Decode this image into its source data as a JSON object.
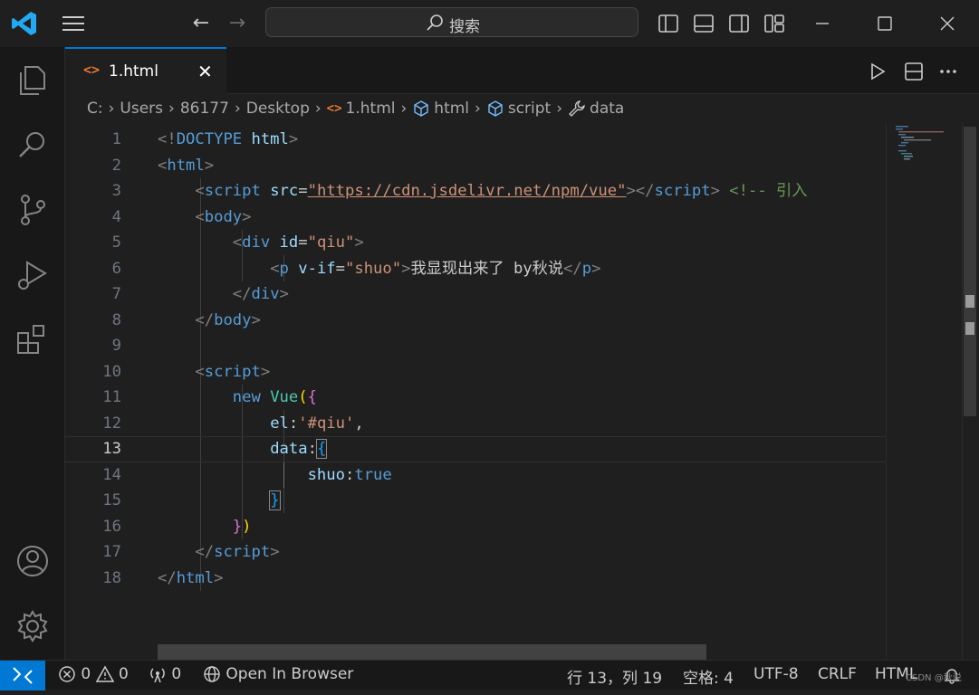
{
  "titlebar": {
    "search_placeholder": "搜索"
  },
  "tab": {
    "icon": "<>",
    "label": "1.html",
    "close": "✕"
  },
  "breadcrumb": {
    "items": [
      "C:",
      "Users",
      "86177",
      "Desktop",
      "1.html",
      "html",
      "script",
      "data"
    ]
  },
  "editor": {
    "line_numbers": [
      "1",
      "2",
      "3",
      "4",
      "5",
      "6",
      "7",
      "8",
      "9",
      "10",
      "11",
      "12",
      "13",
      "14",
      "15",
      "16",
      "17",
      "18"
    ],
    "current_line": "13",
    "lines": {
      "l1": {
        "a": "<!",
        "b": "DOCTYPE",
        "c": " html",
        "d": ">"
      },
      "l2": {
        "a": "<",
        "b": "html",
        "c": ">"
      },
      "l3": {
        "a": "<",
        "b": "script",
        "c": " src",
        "d": "=",
        "e": "\"https://cdn.jsdelivr.net/npm/vue\"",
        "f": "></",
        "g": "script",
        "h": ">",
        "i": " <!-- 引入"
      },
      "l4": {
        "a": "<",
        "b": "body",
        "c": ">"
      },
      "l5": {
        "a": "<",
        "b": "div",
        "c": " id",
        "d": "=",
        "e": "\"qiu\"",
        "f": ">"
      },
      "l6": {
        "a": "<",
        "b": "p",
        "c": " v-if",
        "d": "=",
        "e": "\"shuo\"",
        "f": ">",
        "g": "我显现出来了 by秋说",
        "h": "</",
        "i": "p",
        "j": ">"
      },
      "l7": {
        "a": "</",
        "b": "div",
        "c": ">"
      },
      "l8": {
        "a": "</",
        "b": "body",
        "c": ">"
      },
      "l10": {
        "a": "<",
        "b": "script",
        "c": ">"
      },
      "l11": {
        "a": "new",
        "b": " Vue",
        "c": "(",
        "d": "{"
      },
      "l12": {
        "a": "el",
        "b": ":",
        "c": "'#qiu'",
        "d": ","
      },
      "l13": {
        "a": "data",
        "b": ":",
        "c": "{"
      },
      "l14": {
        "a": "shuo",
        "b": ":",
        "c": "true"
      },
      "l15": {
        "a": "}"
      },
      "l16": {
        "a": "}",
        "b": ")"
      },
      "l17": {
        "a": "</",
        "b": "script",
        "c": ">"
      },
      "l18": {
        "a": "</",
        "b": "html",
        "c": ">"
      }
    }
  },
  "statusbar": {
    "errors": "0",
    "warnings": "0",
    "ports": "0",
    "open_in_browser": "Open In Browser",
    "position": "行 13，列 19",
    "spaces": "空格: 4",
    "encoding": "UTF-8",
    "eol": "CRLF",
    "language": "HTML",
    "watermark": "CSDN @秋说"
  },
  "colors": {
    "accent": "#0078d4",
    "background": "#1f1f1f",
    "tag": "#569cd6",
    "string": "#ce9178",
    "comment": "#6a9955"
  }
}
